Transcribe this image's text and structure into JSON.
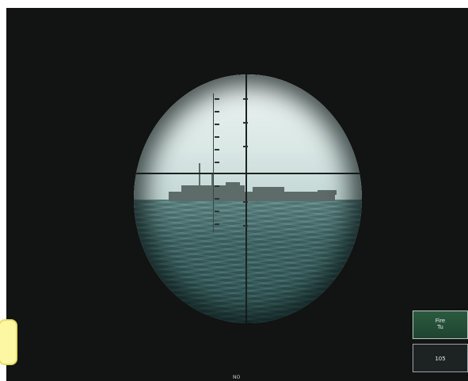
{
  "hud": {
    "fire_button": {
      "label": "Fire",
      "sublabel": "Tu"
    },
    "range_button": {
      "label": "105"
    },
    "bottom_label": "NO"
  },
  "colors": {
    "screen_background": "#121313",
    "sky": "#d9e7e5",
    "sea": "#3f6968",
    "fire_button": "#2b5a3f",
    "side_tab": "#fdf7a3"
  },
  "icons": {
    "crosshair": "crosshair-icon"
  }
}
